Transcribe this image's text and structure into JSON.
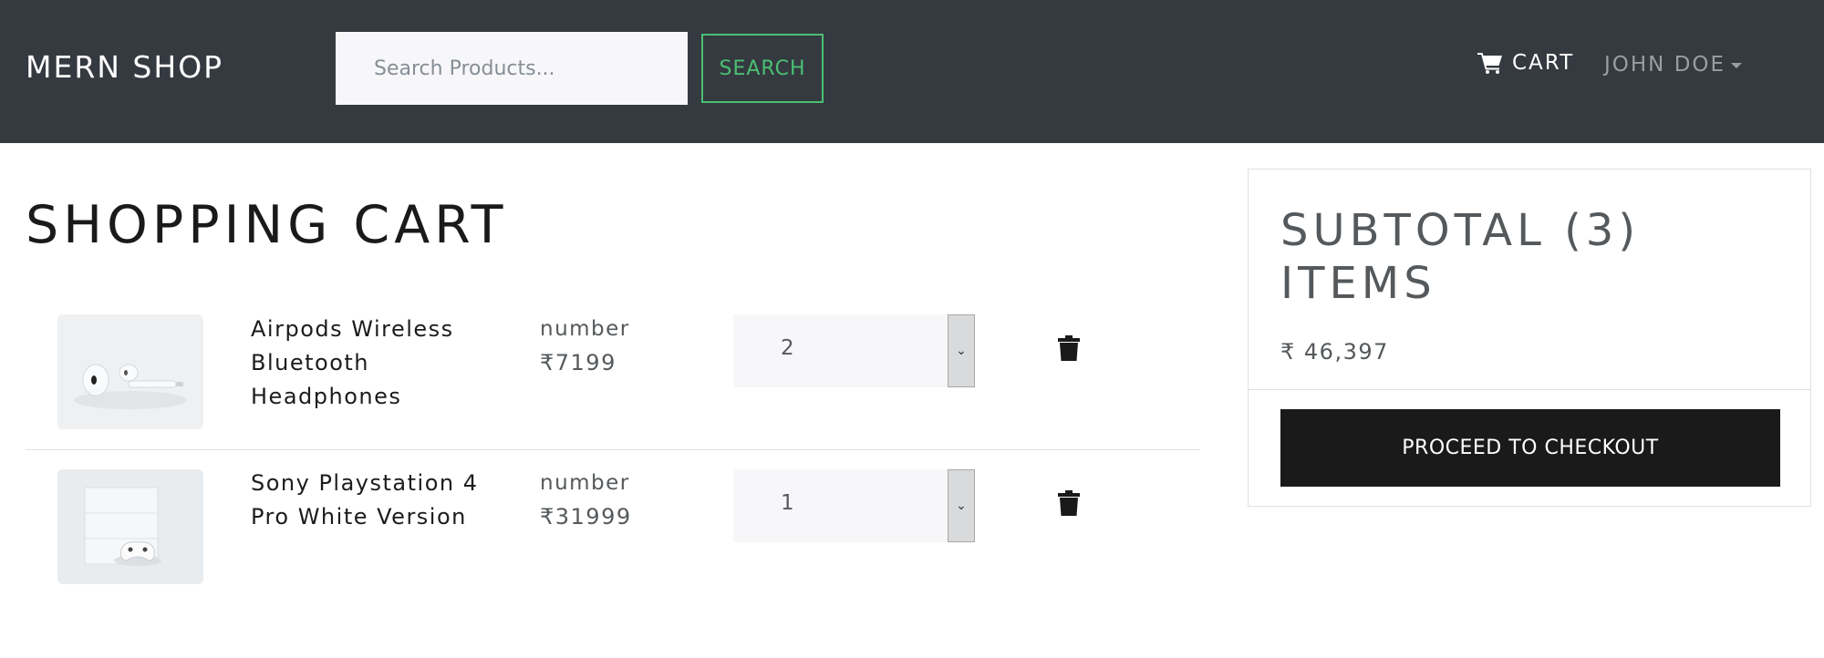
{
  "header": {
    "brand": "MERN SHOP",
    "search": {
      "placeholder": "Search Products...",
      "value": ""
    },
    "search_button": "SEARCH",
    "cart_link": "CART",
    "user_menu": "JOHN DOE"
  },
  "main": {
    "title": "SHOPPING CART",
    "items": [
      {
        "name": "Airpods Wireless Bluetooth Headphones",
        "price_label": "number",
        "price": "₹7199",
        "quantity": "2",
        "image": "airpods-photo"
      },
      {
        "name": "Sony Playstation 4 Pro White Version",
        "price_label": "number",
        "price": "₹31999",
        "quantity": "1",
        "image": "playstation-photo"
      }
    ]
  },
  "summary": {
    "title": "SUBTOTAL (3) ITEMS",
    "total": "₹ 46,397",
    "checkout_button": "PROCEED TO CHECKOUT"
  },
  "colors": {
    "navbar": "#343a40",
    "accent": "#4bbf73",
    "button_dark": "#1a1a1a"
  },
  "icons": {
    "cart": "shopping-cart-icon",
    "trash": "trash-icon",
    "caret": "caret-down-icon",
    "select_arrow": "chevron-down-icon"
  }
}
